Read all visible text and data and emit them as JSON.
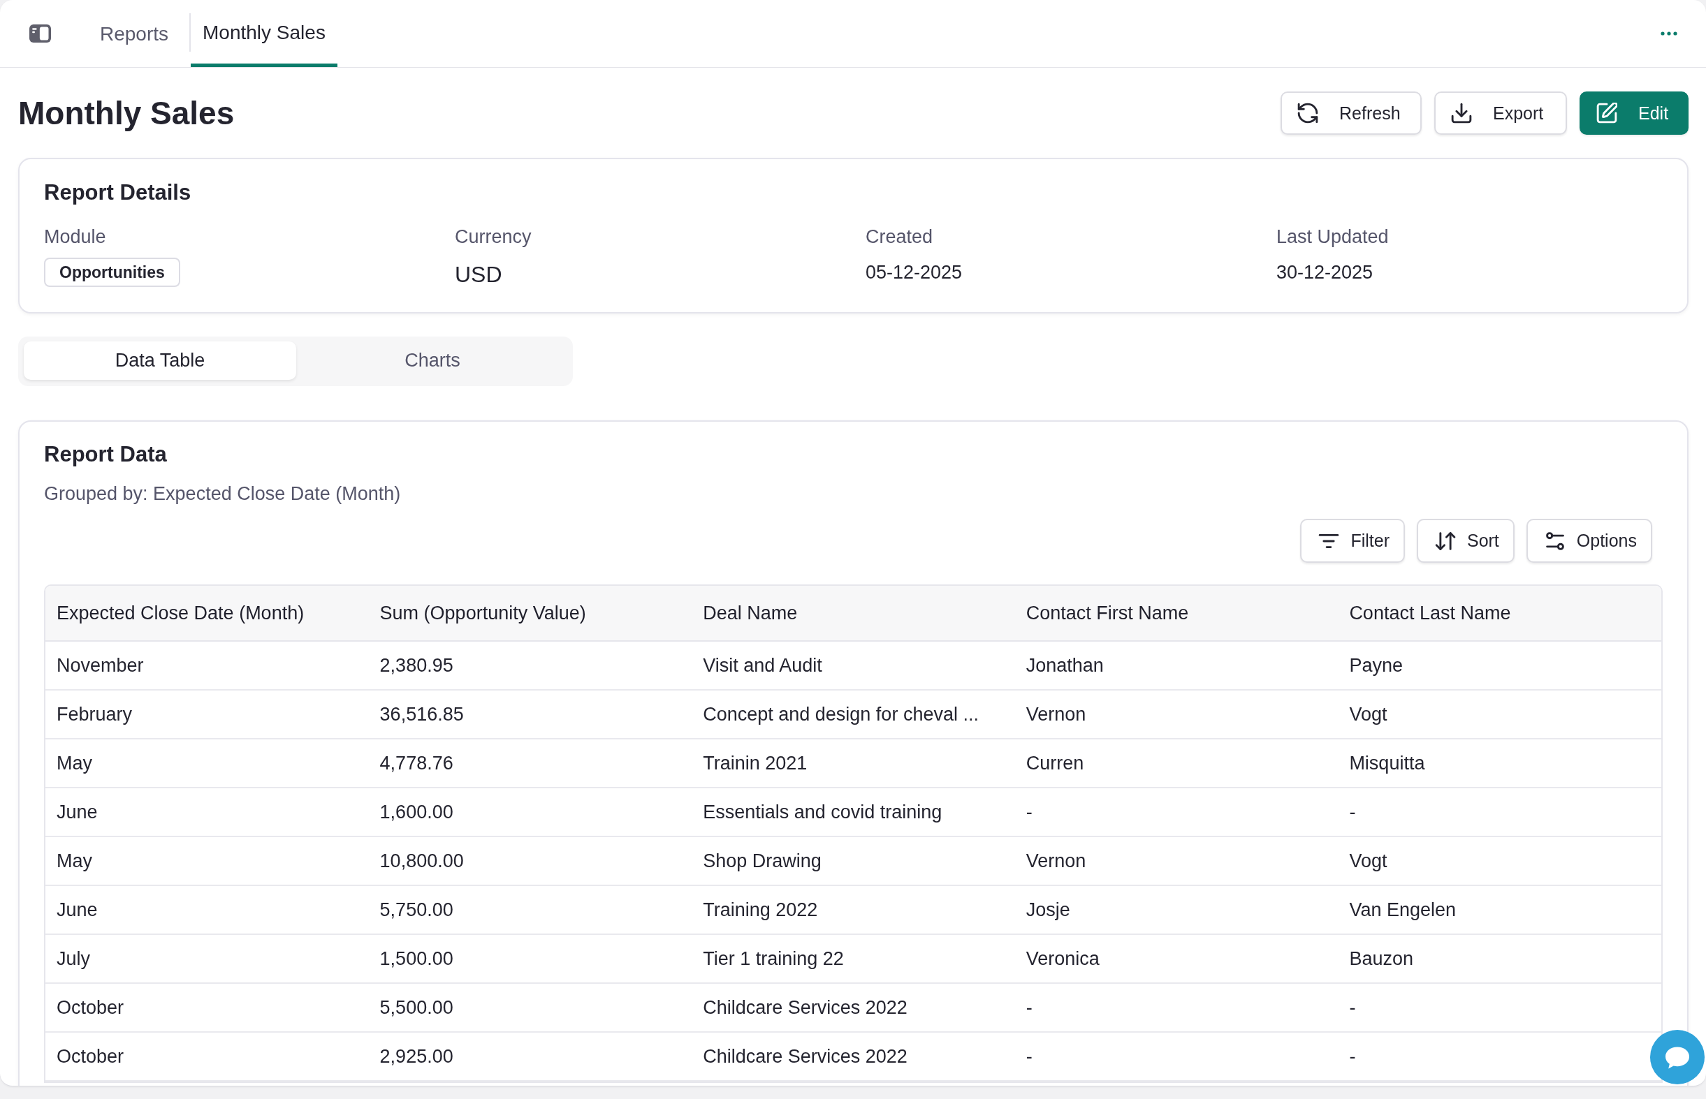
{
  "topbar": {
    "breadcrumbs": [
      {
        "label": "Reports",
        "selected": false
      },
      {
        "label": "Monthly Sales",
        "selected": true
      }
    ]
  },
  "header": {
    "title": "Monthly Sales",
    "actions": [
      {
        "label": "Refresh",
        "kind": "refresh",
        "primary": false
      },
      {
        "label": "Export",
        "kind": "export",
        "primary": false
      },
      {
        "label": "Edit",
        "kind": "edit",
        "primary": true
      }
    ]
  },
  "report_details": {
    "title": "Report Details",
    "fields": [
      {
        "label": "Module",
        "value": "Opportunities",
        "kind": "tag"
      },
      {
        "label": "Currency",
        "value": "USD",
        "kind": "large"
      },
      {
        "label": "Created",
        "value": "05-12-2025",
        "kind": "text"
      },
      {
        "label": "Last Updated",
        "value": "30-12-2025",
        "kind": "text"
      }
    ]
  },
  "view_tabs": [
    {
      "label": "Data Table",
      "selected": true
    },
    {
      "label": "Charts",
      "selected": false
    }
  ],
  "report_data": {
    "title": "Report Data",
    "grouping": "Grouped by: Expected Close Date (Month)",
    "tools": [
      {
        "label": "Filter",
        "kind": "filter"
      },
      {
        "label": "Sort",
        "kind": "sort"
      },
      {
        "label": "Options",
        "kind": "options"
      }
    ],
    "table": {
      "columns": [
        "Expected Close Date (Month)",
        "Sum (Opportunity Value)",
        "Deal Name",
        "Contact First Name",
        "Contact Last Name"
      ],
      "rows": [
        [
          "November",
          "2,380.95",
          "Visit and Audit",
          "Jonathan",
          "Payne"
        ],
        [
          "February",
          "36,516.85",
          "Concept and design for cheval ...",
          "Vernon",
          "Vogt"
        ],
        [
          "May",
          "4,778.76",
          "Trainin 2021",
          "Curren",
          "Misquitta"
        ],
        [
          "June",
          "1,600.00",
          "Essentials and covid training",
          "-",
          "-"
        ],
        [
          "May",
          "10,800.00",
          "Shop Drawing",
          "Vernon",
          "Vogt"
        ],
        [
          "June",
          "5,750.00",
          "Training 2022",
          "Josje",
          "Van Engelen"
        ],
        [
          "July",
          "1,500.00",
          "Tier 1 training 22",
          "Veronica",
          "Bauzon"
        ],
        [
          "October",
          "5,500.00",
          "Childcare Services 2022",
          "-",
          "-"
        ],
        [
          "October",
          "2,925.00",
          "Childcare Services 2022",
          "-",
          "-"
        ]
      ]
    }
  }
}
